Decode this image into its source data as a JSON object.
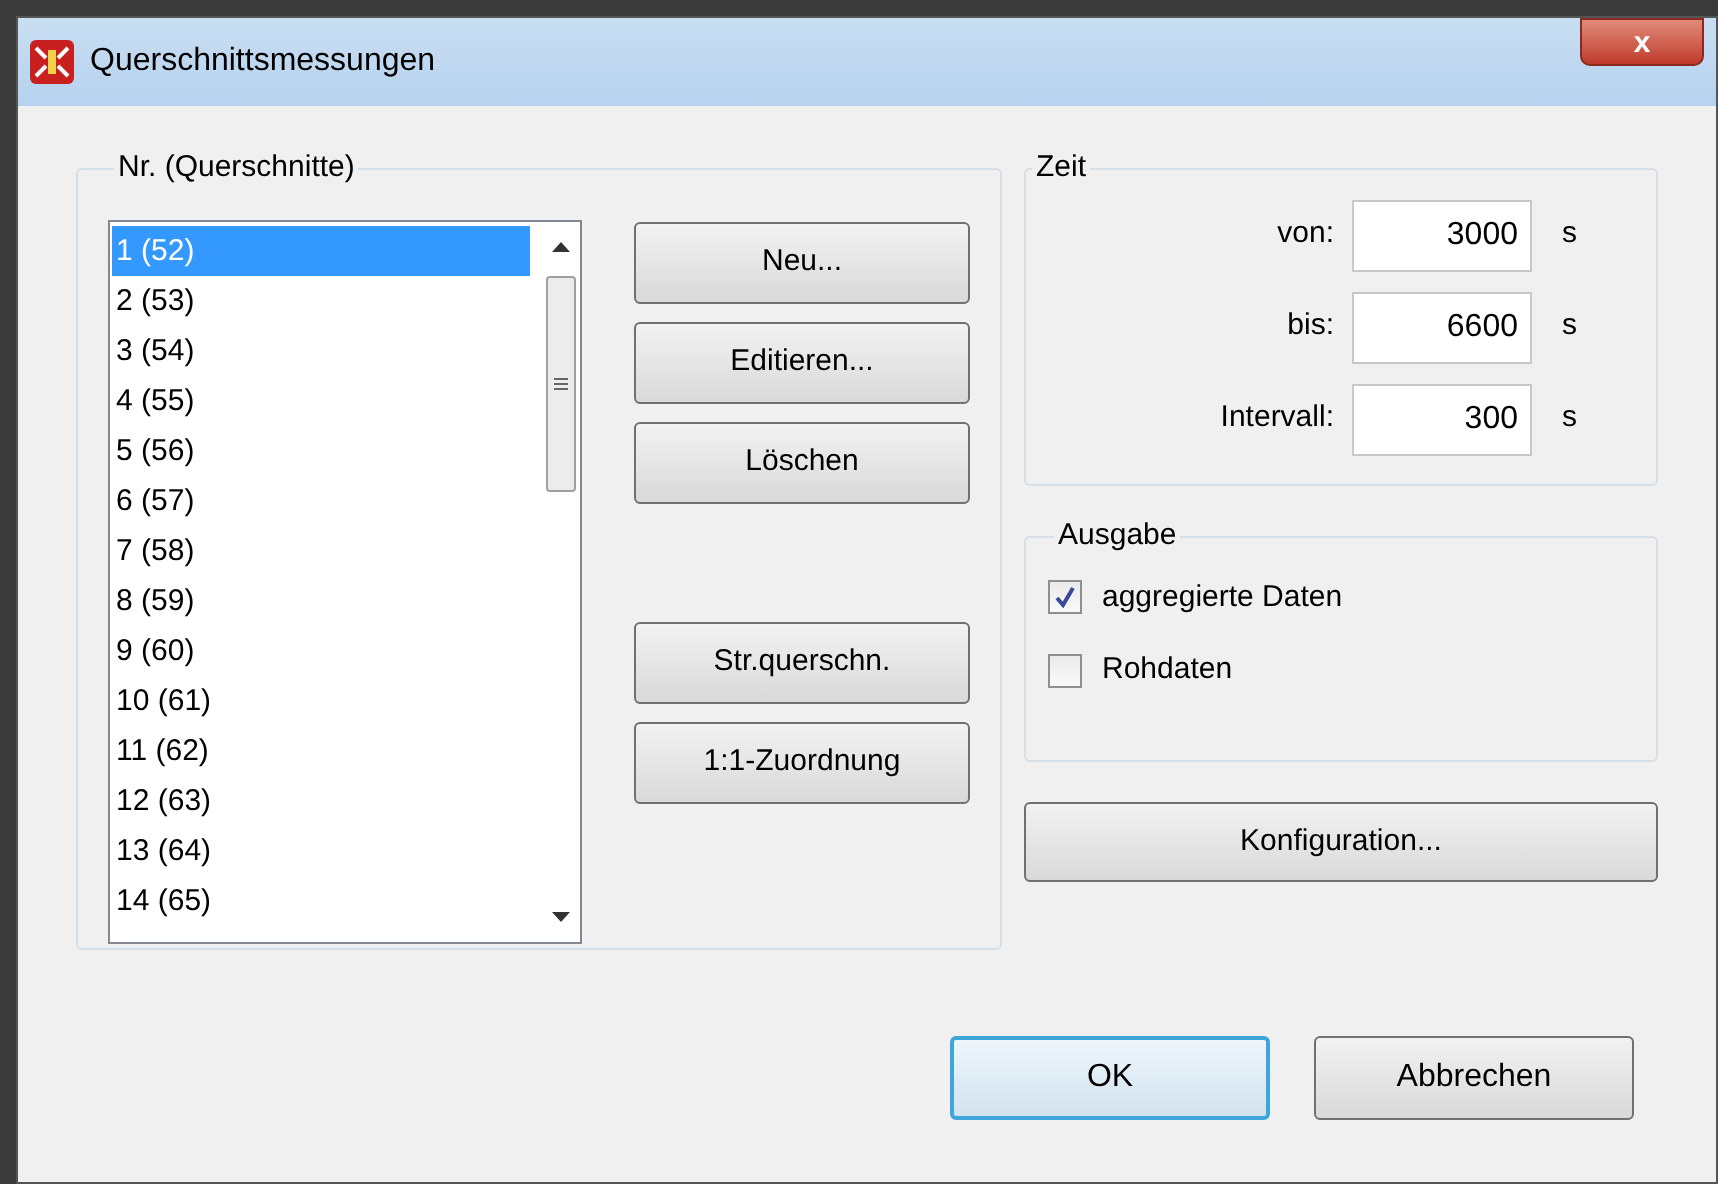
{
  "window": {
    "title": "Querschnittsmessungen",
    "close": "x"
  },
  "sections": {
    "title": "Nr. (Querschnitte)",
    "items": [
      {
        "label": "1 (52)",
        "selected": true
      },
      {
        "label": "2 (53)",
        "selected": false
      },
      {
        "label": "3 (54)",
        "selected": false
      },
      {
        "label": "4 (55)",
        "selected": false
      },
      {
        "label": "5 (56)",
        "selected": false
      },
      {
        "label": "6 (57)",
        "selected": false
      },
      {
        "label": "7 (58)",
        "selected": false
      },
      {
        "label": "8 (59)",
        "selected": false
      },
      {
        "label": "9 (60)",
        "selected": false
      },
      {
        "label": "10 (61)",
        "selected": false
      },
      {
        "label": "11 (62)",
        "selected": false
      },
      {
        "label": "12 (63)",
        "selected": false
      },
      {
        "label": "13 (64)",
        "selected": false
      },
      {
        "label": "14 (65)",
        "selected": false
      }
    ],
    "buttons": [
      "Neu...",
      "Editieren...",
      "Löschen"
    ],
    "buttons_lower": [
      "Str.querschn.",
      "1:1-Zuordnung"
    ]
  },
  "time": {
    "title": "Zeit",
    "fields": [
      {
        "label": "von:",
        "value": "3000",
        "unit": "s"
      },
      {
        "label": "bis:",
        "value": "6600",
        "unit": "s"
      },
      {
        "label": "Intervall:",
        "value": "300",
        "unit": "s"
      }
    ]
  },
  "output": {
    "title": "Ausgabe",
    "options": [
      {
        "label": "aggregierte Daten",
        "checked": true
      },
      {
        "label": "Rohdaten",
        "checked": false
      }
    ]
  },
  "config_button": "Konfiguration...",
  "footer": [
    {
      "label": "OK",
      "default": true
    },
    {
      "label": "Abbrechen",
      "default": false
    }
  ]
}
